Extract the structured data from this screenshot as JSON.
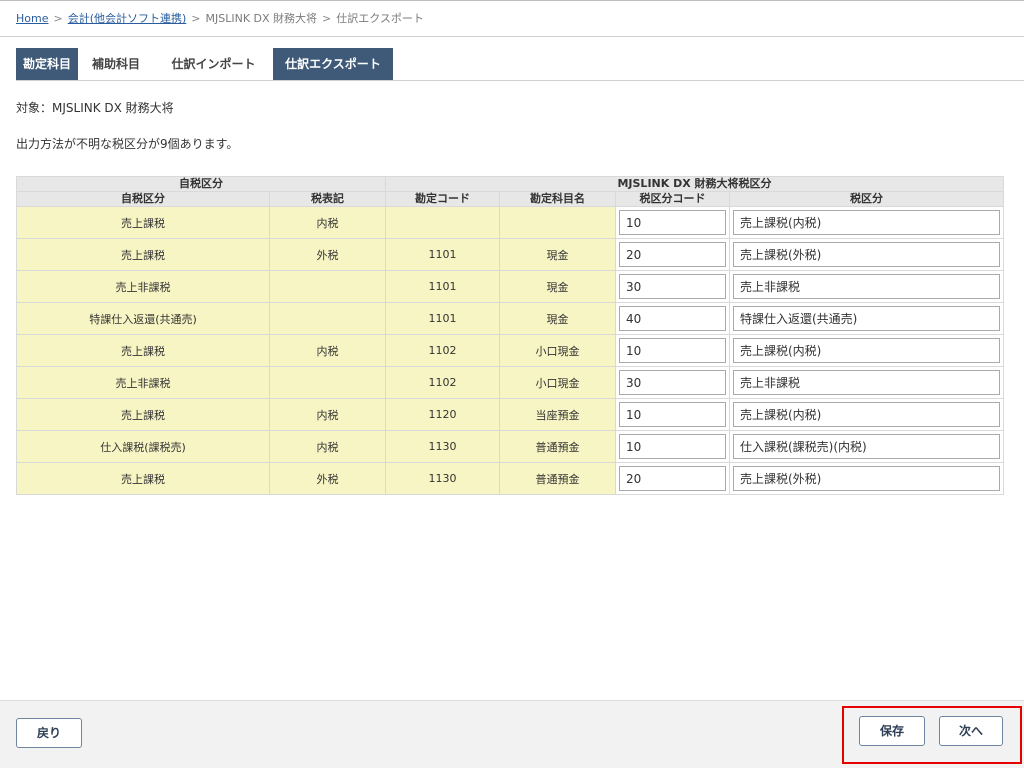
{
  "breadcrumb": {
    "home": "Home",
    "sep1": ">",
    "accounting": "会計(他会計ソフト連携)",
    "sep2": ">",
    "software": "MJSLINK DX 財務大将",
    "sep3": ">",
    "current": "仕訳エクスポート"
  },
  "tabs": [
    {
      "label": "勘定科目",
      "active": true
    },
    {
      "label": "補助科目",
      "active": false
    },
    {
      "label": "仕訳インポート",
      "active": false
    },
    {
      "label": "仕訳エクスポート",
      "active": true
    }
  ],
  "target_text": "対象：MJSLINK DX 財務大将",
  "notice_text": "出力方法が不明な税区分が9個あります。",
  "table": {
    "group_headers": {
      "own": "自税区分",
      "mjs": "MJSLINK DX 財務大将税区分"
    },
    "columns": {
      "own_tax": "自税区分",
      "tax_notation": "税表記",
      "account_code": "勘定コード",
      "account_name": "勘定科目名",
      "tax_code": "税区分コード",
      "tax_class": "税区分"
    },
    "rows": [
      {
        "own_tax": "売上課税",
        "tax_notation": "内税",
        "account_code": "",
        "account_name": "",
        "tax_code": "10",
        "tax_class": "売上課税(内税)"
      },
      {
        "own_tax": "売上課税",
        "tax_notation": "外税",
        "account_code": "1101",
        "account_name": "現金",
        "tax_code": "20",
        "tax_class": "売上課税(外税)"
      },
      {
        "own_tax": "売上非課税",
        "tax_notation": "",
        "account_code": "1101",
        "account_name": "現金",
        "tax_code": "30",
        "tax_class": "売上非課税"
      },
      {
        "own_tax": "特課仕入返還(共通売)",
        "tax_notation": "",
        "account_code": "1101",
        "account_name": "現金",
        "tax_code": "40",
        "tax_class": "特課仕入返還(共通売)"
      },
      {
        "own_tax": "売上課税",
        "tax_notation": "内税",
        "account_code": "1102",
        "account_name": "小口現金",
        "tax_code": "10",
        "tax_class": "売上課税(内税)"
      },
      {
        "own_tax": "売上非課税",
        "tax_notation": "",
        "account_code": "1102",
        "account_name": "小口現金",
        "tax_code": "30",
        "tax_class": "売上非課税"
      },
      {
        "own_tax": "売上課税",
        "tax_notation": "内税",
        "account_code": "1120",
        "account_name": "当座預金",
        "tax_code": "10",
        "tax_class": "売上課税(内税)"
      },
      {
        "own_tax": "仕入課税(課税売)",
        "tax_notation": "内税",
        "account_code": "1130",
        "account_name": "普通預金",
        "tax_code": "10",
        "tax_class": "仕入課税(課税売)(内税)"
      },
      {
        "own_tax": "売上課税",
        "tax_notation": "外税",
        "account_code": "1130",
        "account_name": "普通預金",
        "tax_code": "20",
        "tax_class": "売上課税(外税)"
      }
    ]
  },
  "footer": {
    "back_label": "戻り",
    "save_label": "保存",
    "next_label": "次へ"
  },
  "colors": {
    "tab_active": "#3e5a78",
    "row_bg": "#f8f5c4",
    "highlight": "#e60000",
    "link": "#2a5d9f"
  }
}
